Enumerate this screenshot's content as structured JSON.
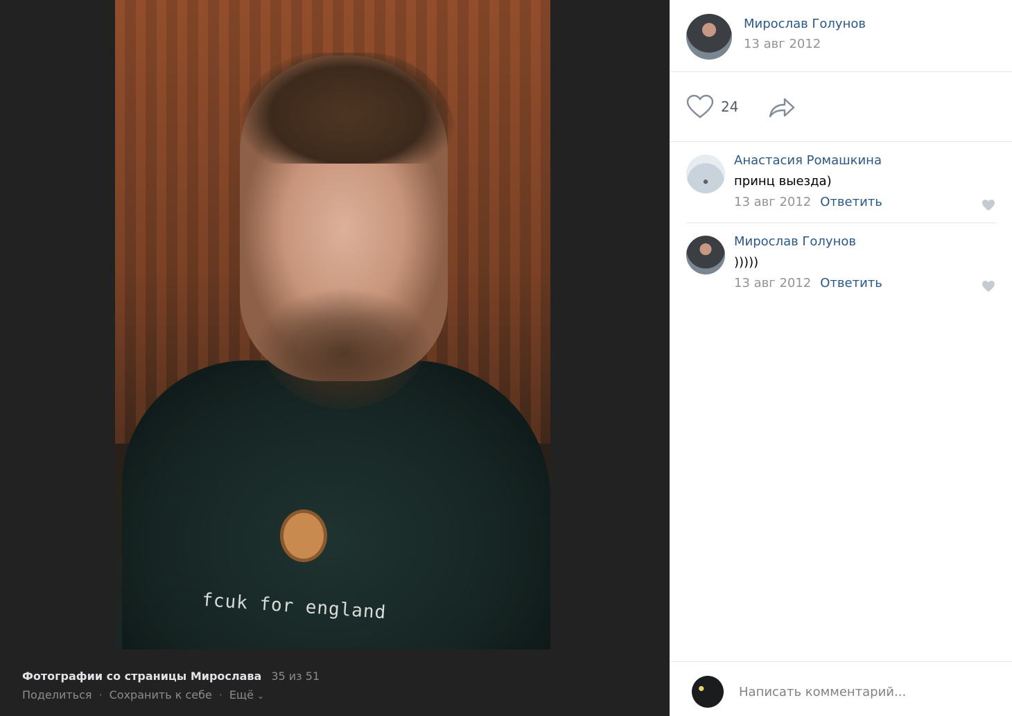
{
  "viewer": {
    "photo_shirt_text": "fcuk for england",
    "album_title": "Фотографии со страницы Мирослава",
    "counter": "35 из 51",
    "actions": {
      "share": "Поделиться",
      "save": "Сохранить к себе",
      "more": "Ещё",
      "separator": "·"
    }
  },
  "post": {
    "author": "Мирослав Голунов",
    "date": "13 авг 2012",
    "likes": "24",
    "like_icon": "heart-icon",
    "share_icon": "share-arrow-icon"
  },
  "comments": [
    {
      "author": "Анастасия Ромашкина",
      "text": "принц выезда)",
      "date": "13 авг 2012",
      "reply": "Ответить"
    },
    {
      "author": "Мирослав Голунов",
      "text": ")))))",
      "date": "13 авг 2012",
      "reply": "Ответить"
    }
  ],
  "composer": {
    "placeholder": "Написать комментарий..."
  },
  "colors": {
    "link": "#2a5885",
    "muted": "#939393",
    "viewer_bg": "#222222"
  }
}
